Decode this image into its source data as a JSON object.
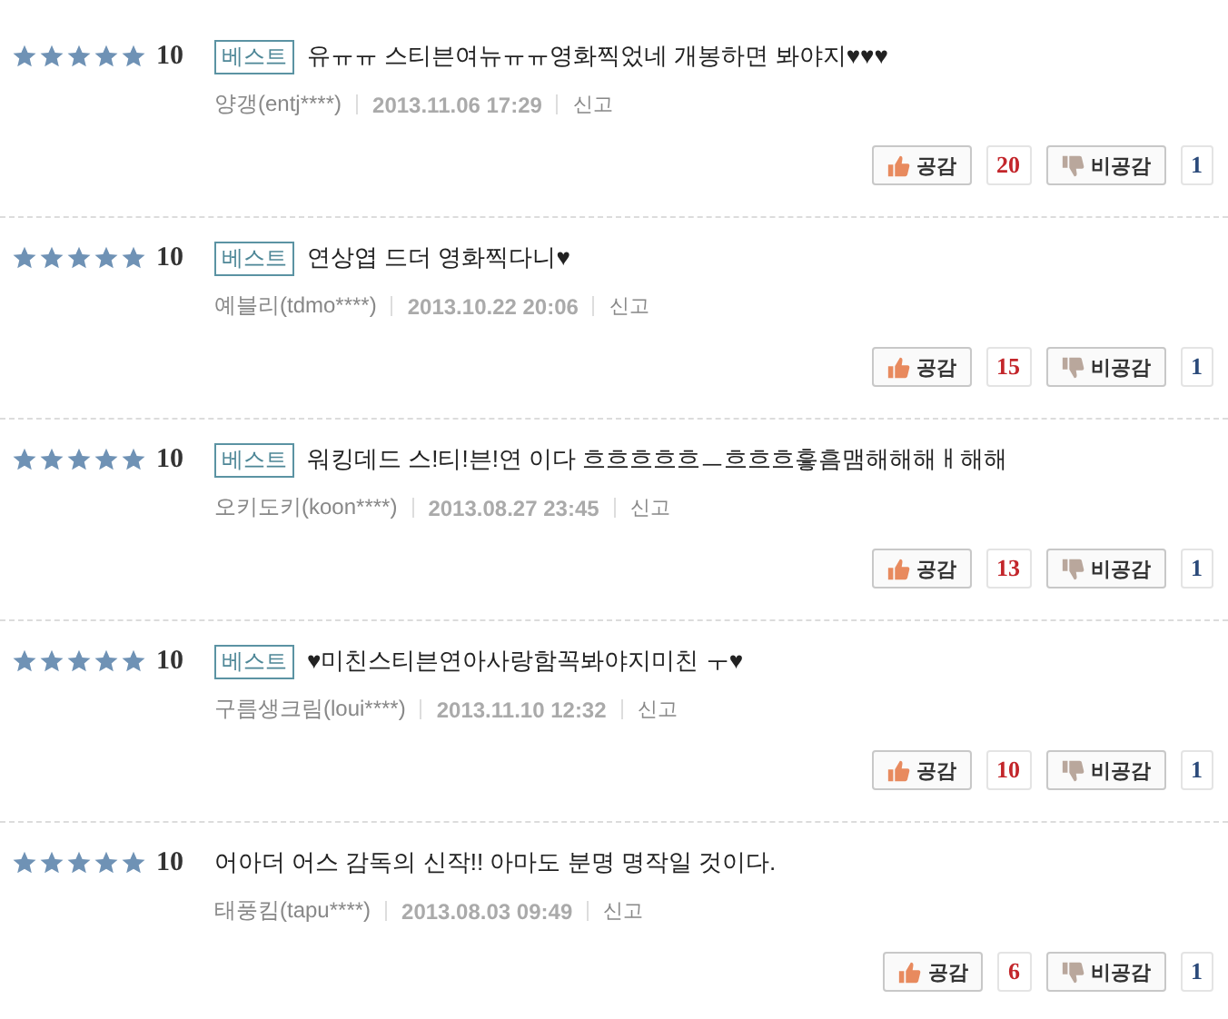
{
  "reviews": [
    {
      "stars": 5,
      "score": "10",
      "badge": "베스트",
      "text": "유ㅠㅠ 스티븐여뉴ㅠㅠ영화찍었네 개봉하면 봐야지♥♥♥",
      "author": "양갱(entj****)",
      "date": "2013.11.06 17:29",
      "report": "신고",
      "like_label": "공감",
      "like_count": "20",
      "dislike_label": "비공감",
      "dislike_count": "1"
    },
    {
      "stars": 5,
      "score": "10",
      "badge": "베스트",
      "text": "연상엽 드더 영화찍다니♥",
      "author": "예블리(tdmo****)",
      "date": "2013.10.22 20:06",
      "report": "신고",
      "like_label": "공감",
      "like_count": "15",
      "dislike_label": "비공감",
      "dislike_count": "1"
    },
    {
      "stars": 5,
      "score": "10",
      "badge": "베스트",
      "text": "워킹데드 스!티!븐!연 이다 흐흐흐흐흐ㅡ흐흐흐흫흠맴해해해ㅐ해해",
      "author": "오키도키(koon****)",
      "date": "2013.08.27 23:45",
      "report": "신고",
      "like_label": "공감",
      "like_count": "13",
      "dislike_label": "비공감",
      "dislike_count": "1"
    },
    {
      "stars": 5,
      "score": "10",
      "badge": "베스트",
      "text": "♥미친스티븐연아사랑함꼭봐야지미친 ㅜ♥",
      "author": "구름생크림(loui****)",
      "date": "2013.11.10 12:32",
      "report": "신고",
      "like_label": "공감",
      "like_count": "10",
      "dislike_label": "비공감",
      "dislike_count": "1"
    },
    {
      "stars": 5,
      "score": "10",
      "text": "어아더 어스 감독의 신작!! 아마도 분명 명작일 것이다.",
      "author": "태풍킴(tapu****)",
      "date": "2013.08.03 09:49",
      "report": "신고",
      "like_label": "공감",
      "like_count": "6",
      "dislike_label": "비공감",
      "dislike_count": "1"
    }
  ]
}
